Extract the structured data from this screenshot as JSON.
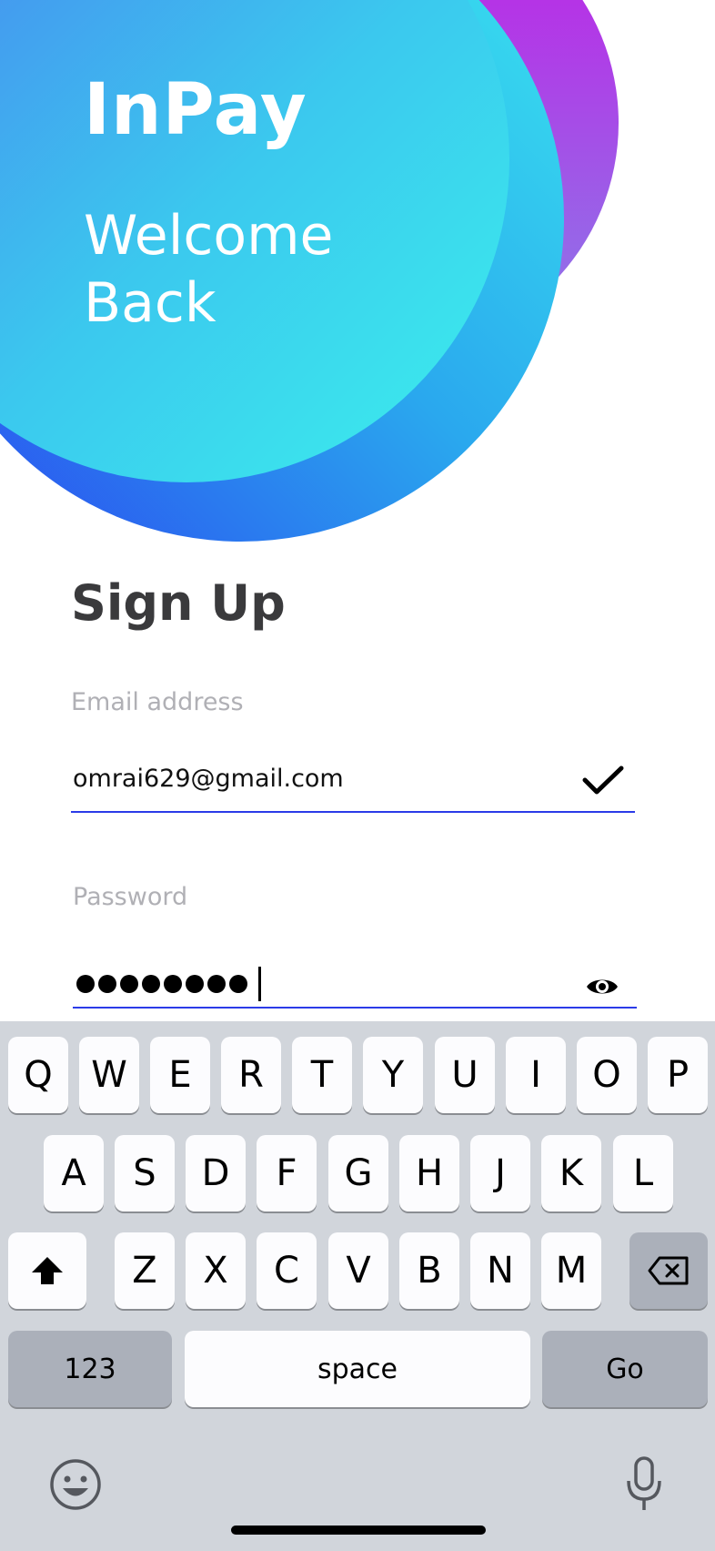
{
  "app": {
    "brand": "InPay",
    "welcome_line1": "Welcome",
    "welcome_line2": "Back"
  },
  "form": {
    "title": "Sign Up",
    "email_label": "Email address",
    "email_value": "omrai629@gmail.com",
    "password_label": "Password",
    "password_masked_length": 8
  },
  "keyboard": {
    "row1": [
      "Q",
      "W",
      "E",
      "R",
      "T",
      "Y",
      "U",
      "I",
      "O",
      "P"
    ],
    "row2": [
      "A",
      "S",
      "D",
      "F",
      "G",
      "H",
      "J",
      "K",
      "L"
    ],
    "row3": [
      "Z",
      "X",
      "C",
      "V",
      "B",
      "N",
      "M"
    ],
    "numbers_key": "123",
    "space_key": "space",
    "go_key": "Go"
  },
  "colors": {
    "accent_underline": "#2b3be8",
    "bubble_cyan": "#3be8ee",
    "bubble_blue": "#2b47f0",
    "bubble_purple": "#c21ee6"
  },
  "icons": {
    "email_valid": "checkmark-icon",
    "password_visibility": "eye-icon",
    "shift": "shift-icon",
    "delete": "backspace-icon",
    "emoji": "emoji-icon",
    "dictation": "microphone-icon"
  }
}
